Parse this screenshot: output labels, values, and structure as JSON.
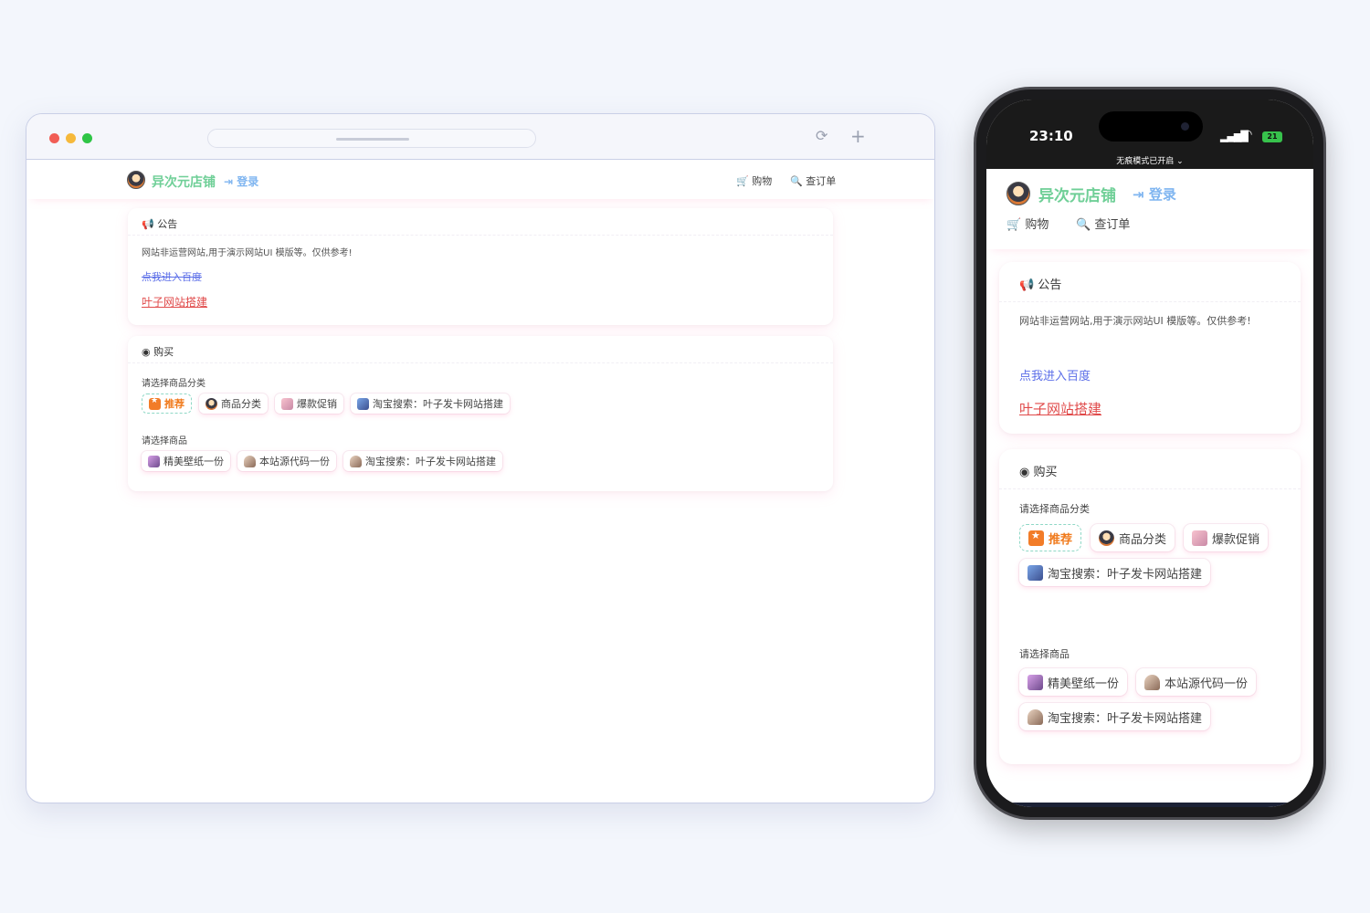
{
  "site": {
    "brand": "异次元店铺",
    "login": "登录",
    "nav_shop": "购物",
    "nav_orders": "查订单"
  },
  "notice": {
    "title": "公告",
    "text": "网站非运营网站,用于演示网站UI 模版等。仅供参考!",
    "link_baidu": "点我进入百度",
    "link_build": "叶子网站搭建"
  },
  "buy": {
    "title": "购买",
    "category_label": "请选择商品分类",
    "categories": [
      {
        "label": "推荐",
        "icon": "star-icon"
      },
      {
        "label": "商品分类",
        "icon": "avatar-icon"
      },
      {
        "label": "爆款促销",
        "icon": "anime-avatar-icon"
      },
      {
        "label": "淘宝搜索：叶子发卡网站搭建",
        "icon": "anime-avatar-icon"
      }
    ],
    "product_label": "请选择商品",
    "products": [
      {
        "label": "精美壁纸一份",
        "icon": "anime-avatar-icon"
      },
      {
        "label": "本站源代码一份",
        "icon": "anime-avatar-icon"
      },
      {
        "label": "淘宝搜索：叶子发卡网站搭建",
        "icon": "anime-avatar-icon"
      }
    ]
  },
  "phone": {
    "time": "23:10",
    "battery": "21",
    "incognito": "无痕模式已开启 ⌄"
  },
  "icons": {
    "megaphone": "📢",
    "buy": "●",
    "cart": "🛒",
    "search": "🔍",
    "login": "⇥"
  },
  "colors": {
    "brand": "#6fcf97",
    "login": "#7fb5f0",
    "link_blue": "#5b6ee8",
    "link_red": "#e04a4a",
    "active_chip": "#f07a1c"
  }
}
